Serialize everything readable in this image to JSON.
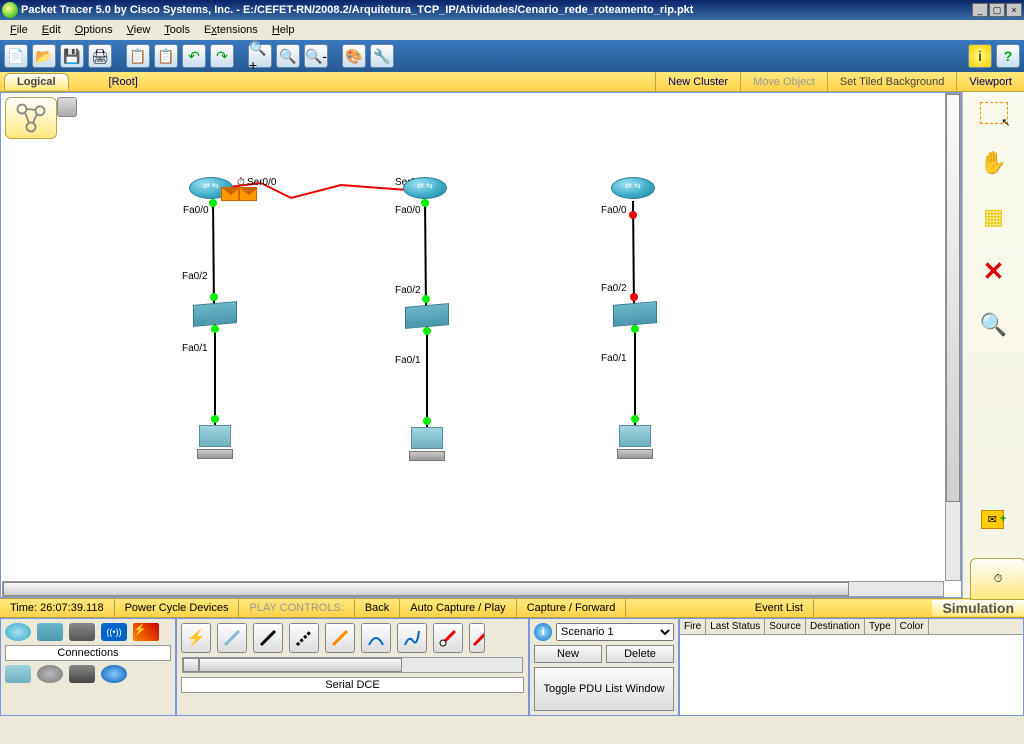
{
  "title": "Packet Tracer 5.0 by Cisco Systems, Inc. - E:/CEFET-RN/2008.2/Arquitetura_TCP_IP/Atividades/Cenario_rede_roteamento_rip.pkt",
  "menus": [
    "File",
    "Edit",
    "Options",
    "View",
    "Tools",
    "Extensions",
    "Help"
  ],
  "topbar": {
    "logical": "Logical",
    "root": "[Root]",
    "new_cluster": "New Cluster",
    "move_object": "Move Object",
    "set_bg": "Set Tiled Background",
    "viewport": "Viewport"
  },
  "right_tools": [
    "select",
    "hand",
    "note",
    "delete",
    "inspect",
    "add-simple",
    "add-complex"
  ],
  "control": {
    "time_label": "Time: 26:07:39.118",
    "power": "Power Cycle Devices",
    "play_label": "PLAY CONTROLS:",
    "back": "Back",
    "auto": "Auto Capture / Play",
    "capture": "Capture / Forward",
    "event": "Event List",
    "simulation": "Simulation"
  },
  "devices_label": "Connections",
  "conn_type": "Serial DCE",
  "scenario": {
    "name": "Scenario 1",
    "new": "New",
    "del": "Delete",
    "toggle": "Toggle PDU List Window"
  },
  "pdu_headers": [
    "Fire",
    "Last Status",
    "Source",
    "Destination",
    "Type",
    "Color"
  ],
  "ports": {
    "ser00a": "Ser0/0",
    "ser00b": "Ser0/0",
    "fa00": "Fa0/0",
    "fa01": "Fa0/1",
    "fa02": "Fa0/2"
  },
  "clock_icon": "⏱"
}
